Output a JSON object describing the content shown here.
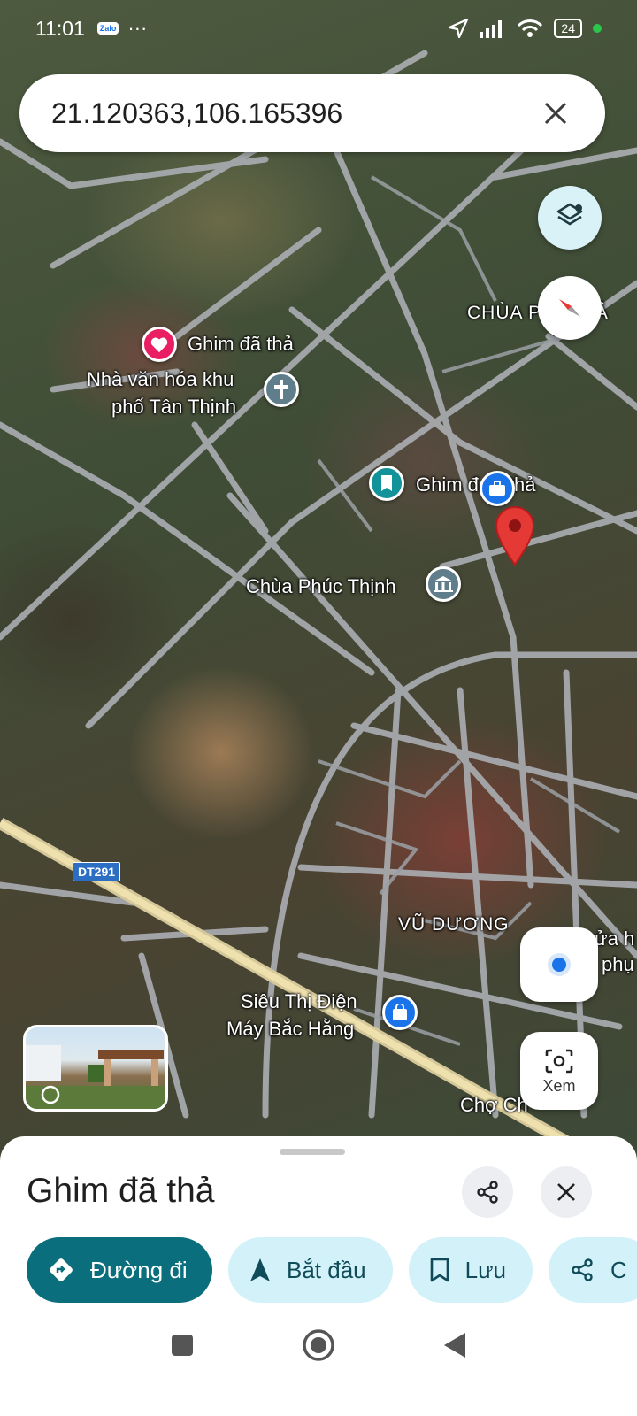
{
  "status_bar": {
    "time": "11:01",
    "notification_app": "Zalo",
    "more_indicator": "···",
    "battery": "24"
  },
  "search": {
    "value": "21.120363,106.165396"
  },
  "map_labels": {
    "dropped_pin_top": "Ghim đã thả",
    "cultural_house_line1": "Nhà văn hóa khu",
    "cultural_house_line2": "phố Tân Thịnh",
    "chua_top_right": "CHÙA P",
    "chua_top_right_tail": "LÂ",
    "dropped_pin_mid": "Ghim đ",
    "dropped_pin_mid_tail": "thả",
    "pagoda": "Chùa Phúc Thịnh",
    "road_shield": "DT291",
    "district": "VŨ DƯƠNG",
    "right_edge_1": "ửa h",
    "right_edge_2": "phụ",
    "store_line1": "Siêu Thị Điện",
    "store_line2": "Máy Bắc Hằng",
    "market": "Chợ Ch"
  },
  "controls": {
    "lens_label": "Xem"
  },
  "sheet": {
    "title": "Ghim đã thả",
    "chips": [
      {
        "label": "Đường đi",
        "icon": "directions-icon"
      },
      {
        "label": "Bắt đầu",
        "icon": "navigation-arrow-icon"
      },
      {
        "label": "Lưu",
        "icon": "bookmark-icon"
      },
      {
        "label": "C",
        "icon": "share-icon"
      }
    ]
  },
  "colors": {
    "primary_chip": "#0b6e7c",
    "light_chip": "#d2f1f8",
    "pin_red": "#e53935",
    "location_blue": "#1a73e8"
  }
}
